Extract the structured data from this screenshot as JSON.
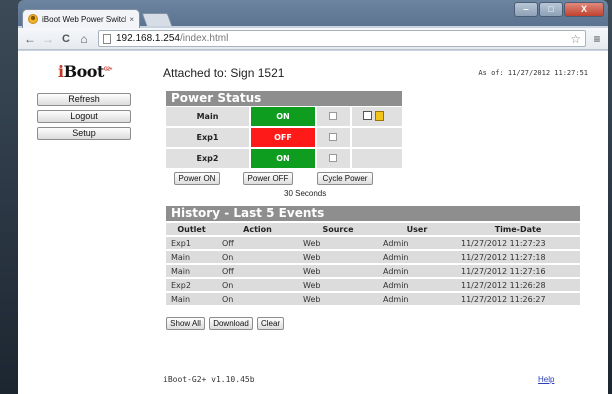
{
  "browser": {
    "tab_title": "iBoot Web Power Switch",
    "tab_close": "×",
    "url_host": "192.168.1.254",
    "url_path": "/index.html",
    "back": "←",
    "forward": "→",
    "reload": "C",
    "home": "⌂",
    "star": "☆",
    "menu": "≡",
    "minimize": "‒",
    "maximize": "□",
    "close": "X"
  },
  "logo": {
    "i": "i",
    "text": "Boot",
    "sup": "G2+"
  },
  "sidebar": {
    "refresh": "Refresh",
    "logout": "Logout",
    "setup": "Setup"
  },
  "header": {
    "attached": "Attached to: Sign 1521",
    "as_of": "As of: 11/27/2012 11:27:51"
  },
  "power_status": {
    "title": "Power Status",
    "outlets": [
      {
        "name": "Main",
        "state": "ON",
        "color": "#0f9d1f"
      },
      {
        "name": "Exp1",
        "state": "OFF",
        "color": "#ff1a1a"
      },
      {
        "name": "Exp2",
        "state": "ON",
        "color": "#0f9d1f"
      }
    ],
    "power_on": "Power ON",
    "power_off": "Power OFF",
    "cycle_power": "Cycle Power",
    "cycle_duration": "30 Seconds"
  },
  "history": {
    "title": "History - Last 5 Events",
    "columns": [
      "Outlet",
      "Action",
      "Source",
      "User",
      "Time-Date"
    ],
    "rows": [
      [
        "Exp1",
        "Off",
        "Web",
        "Admin",
        "11/27/2012 11:27:23"
      ],
      [
        "Main",
        "On",
        "Web",
        "Admin",
        "11/27/2012 11:27:18"
      ],
      [
        "Main",
        "Off",
        "Web",
        "Admin",
        "11/27/2012 11:27:16"
      ],
      [
        "Exp2",
        "On",
        "Web",
        "Admin",
        "11/27/2012 11:26:28"
      ],
      [
        "Main",
        "On",
        "Web",
        "Admin",
        "11/27/2012 11:26:27"
      ]
    ],
    "show_all": "Show All",
    "download": "Download",
    "clear": "Clear"
  },
  "footer": {
    "version": "iBoot-G2+ v1.10.45b",
    "help": "Help"
  }
}
